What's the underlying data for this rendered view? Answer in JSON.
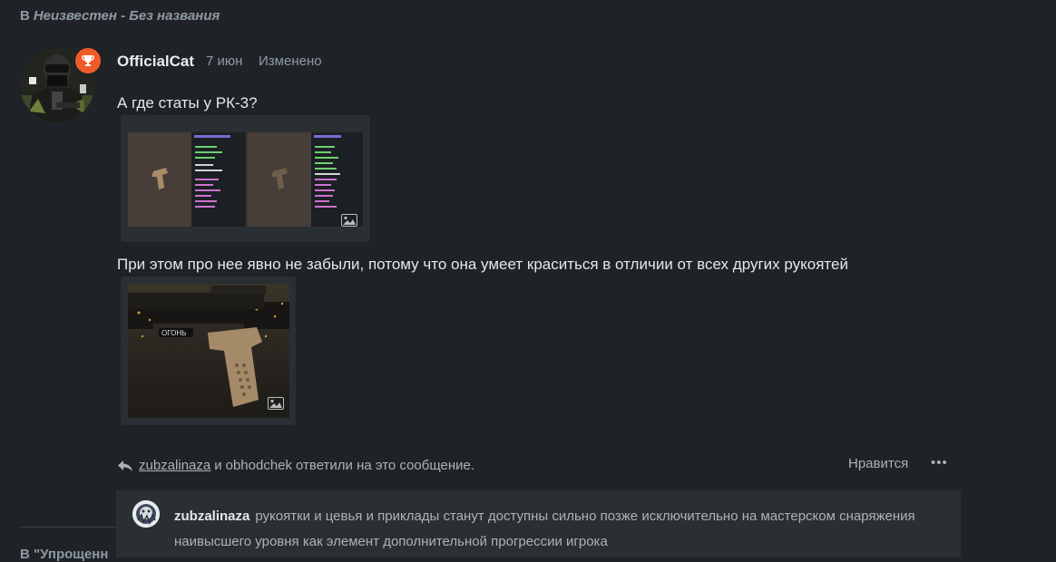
{
  "header": {
    "prefix": "В",
    "location": "Неизвестен - Без названия"
  },
  "post": {
    "author": "OfficialCat",
    "date": "7 июн",
    "edited": "Изменено",
    "text1": "А где статы у РК-3?",
    "text2": "При этом про нее явно не забыли, потому что она умеет краситься в отличии от всех других рукоятей",
    "images": [
      {
        "type": "screenshot-pair",
        "icon": "image-icon"
      },
      {
        "type": "weapon-grip",
        "icon": "image-icon",
        "caption": "ОГОНЬ"
      }
    ],
    "replies": {
      "user1": "zubzalinaza",
      "connector": "и",
      "user2": "obhodchek",
      "suffix": "ответили на это сообщение."
    },
    "like_label": "Нравится",
    "more_label": "•••"
  },
  "reply_preview": {
    "author": "zubzalinaza",
    "text": "рукоятки и цевья и приклады станут доступны сильно позже исключительно на мастерском снаряжения наивысшего уровня как элемент дополнительной прогрессии игрока"
  },
  "next_thread": {
    "prefix": "В",
    "label": "\"Упрощенн"
  },
  "colors": {
    "background": "#1f2327",
    "card": "#2a2f33",
    "badge": "#f05a28",
    "muted": "#8e9aa3"
  }
}
